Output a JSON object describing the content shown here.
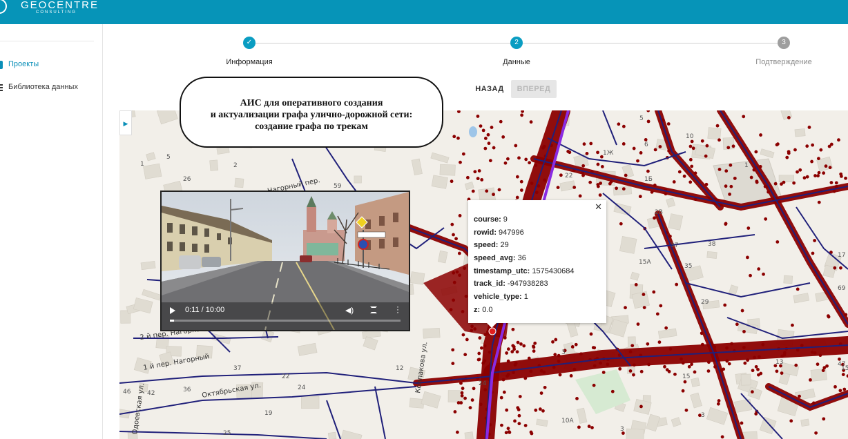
{
  "brand": {
    "name": "GEOCENTRE",
    "sub": "CONSULTING"
  },
  "sidebar": {
    "items": [
      {
        "label": "Проекты",
        "icon": "project-icon",
        "active": true
      },
      {
        "label": "Библиотека данных",
        "icon": "library-icon",
        "active": false
      }
    ]
  },
  "stepper": {
    "steps": [
      {
        "number": "✓",
        "label": "Информация",
        "state": "done"
      },
      {
        "number": "2",
        "label": "Данные",
        "state": "active"
      },
      {
        "number": "3",
        "label": "Подтверждение",
        "state": "idle"
      }
    ]
  },
  "actions": {
    "back_label": "НАЗАД",
    "next_label": "ВПЕРЕД"
  },
  "callout": {
    "lines": [
      "АИС для оперативного создания",
      "и актуализации графа улично-дорожной сети:",
      "создание графа по трекам"
    ]
  },
  "video": {
    "time": "0:11 / 10:00",
    "progress": 0.018
  },
  "popup": {
    "rows": [
      {
        "key": "course:",
        "value": " 9"
      },
      {
        "key": "rowid:",
        "value": " 947996"
      },
      {
        "key": "speed:",
        "value": " 29"
      },
      {
        "key": "speed_avg:",
        "value": " 36"
      },
      {
        "key": "timestamp_utc:",
        "value": " 1575430684"
      },
      {
        "key": "track_id:",
        "value": " -947938283"
      },
      {
        "key": "vehicle_type:",
        "value": " 1"
      },
      {
        "key": "z:",
        "value": " 0.0"
      }
    ]
  },
  "map": {
    "labels": [
      "1",
      "5",
      "2",
      "26",
      "59",
      "72",
      "22",
      "5",
      "6",
      "1Ж",
      "1Б",
      "10",
      "1",
      "2В",
      "37",
      "38",
      "15А",
      "35",
      "17",
      "29",
      "69",
      "47",
      "3",
      "24",
      "22",
      "12",
      "37",
      "24",
      "19",
      "15",
      "36",
      "42",
      "46",
      "13",
      "15",
      "10А",
      "3",
      "25",
      "3"
    ],
    "streets": [
      "Нагорный пер.",
      "2 й пер. Нагорный",
      "1 й пер. Нагорный",
      "Колпакова ул.",
      "Октябрьская ул.",
      "Одоевская ул."
    ],
    "colors": {
      "tracks": "#8b0000",
      "roads": "#20207a",
      "highlight": "#8a2be2",
      "land": "#f2efe9",
      "building": "#e0dcd2"
    }
  }
}
